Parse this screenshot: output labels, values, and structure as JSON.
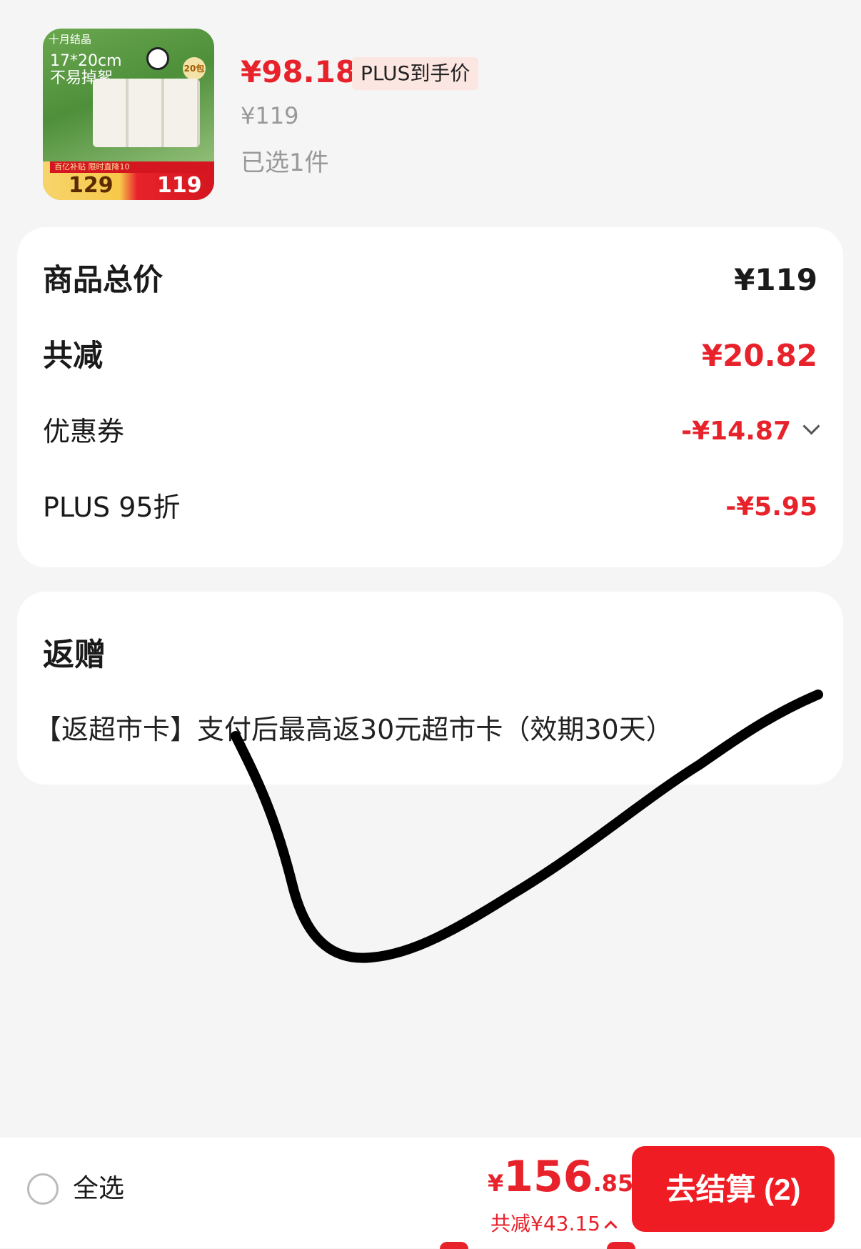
{
  "product": {
    "thumb": {
      "brand": "十月结晶",
      "size_text": "17*20cm",
      "slogan": "不易掉絮",
      "badge": "20包",
      "band_title": "百亿补贴  限时直降10",
      "price_before": "129",
      "price_after": "119"
    },
    "price": "¥98.18",
    "plus_tag": "PLUS到手价",
    "original_price": "¥119",
    "selected_count": "已选1件"
  },
  "summary": {
    "total_label": "商品总价",
    "total_value": "¥119",
    "discount_label": "共减",
    "discount_value": "¥20.82",
    "coupon_label": "优惠券",
    "coupon_value": "-¥14.87",
    "plus_label": "PLUS 95折",
    "plus_value": "-¥5.95"
  },
  "gift": {
    "title": "返赠",
    "text": "【返超市卡】支付后最高返30元超市卡（效期30天）"
  },
  "footer": {
    "select_all": "全选",
    "currency": "¥",
    "total_int": "156",
    "total_dec": ".85",
    "saved": "共减¥43.15",
    "checkout": "去结算 (2)"
  },
  "colors": {
    "accent_red": "#e8222b",
    "checkout_bg": "#f01c24",
    "background": "#f5f5f5",
    "annotation_stroke": "#000000"
  }
}
